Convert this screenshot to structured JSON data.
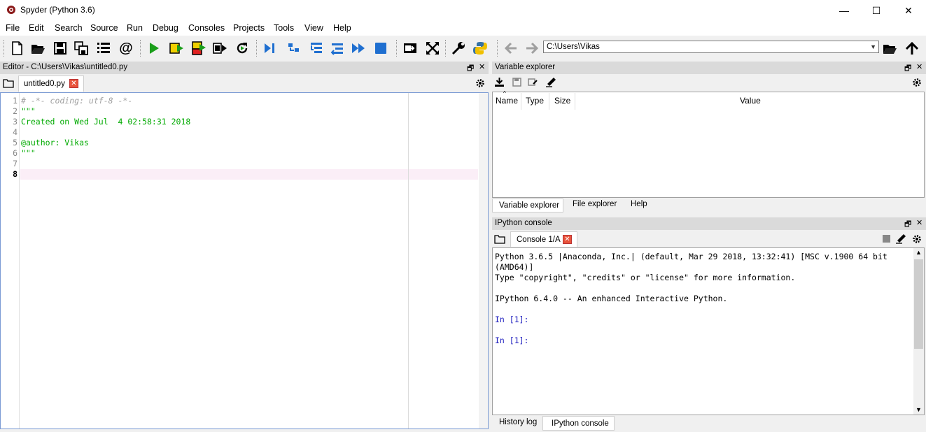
{
  "window": {
    "title": "Spyder (Python 3.6)",
    "minimize": "—",
    "maximize": "☐",
    "close": "✕"
  },
  "menu": [
    "File",
    "Edit",
    "Search",
    "Source",
    "Run",
    "Debug",
    "Consoles",
    "Projects",
    "Tools",
    "View",
    "Help"
  ],
  "toolbar": {
    "working_directory": "C:\\Users\\Vikas",
    "icons": [
      "new-file-icon",
      "open-file-icon",
      "save-icon",
      "save-all-icon",
      "outline-icon",
      "at-icon",
      "run-icon",
      "run-cell-icon",
      "run-cell-advance-icon",
      "run-selection-icon",
      "rerun-icon",
      "debug-icon",
      "step-icon",
      "step-into-icon",
      "step-return-icon",
      "continue-icon",
      "stop-icon",
      "maximize-pane-icon",
      "fullscreen-icon",
      "preferences-icon",
      "python-path-icon",
      "back-icon",
      "forward-icon",
      "browse-icon",
      "parent-dir-icon"
    ]
  },
  "editor": {
    "pane_title": "Editor - C:\\Users\\Vikas\\untitled0.py",
    "tab_label": "untitled0.py",
    "current_line": 8,
    "colors": {
      "comment": "#a0a0a0",
      "docstring": "#00aa00",
      "linenum": "#888888",
      "current_line_bg": "#fbeef7"
    },
    "lines": [
      {
        "num": "1",
        "text": "# -*- coding: utf-8 -*-"
      },
      {
        "num": "2",
        "text": "\"\"\""
      },
      {
        "num": "3",
        "text": "Created on Wed Jul  4 02:58:31 2018"
      },
      {
        "num": "4",
        "text": ""
      },
      {
        "num": "5",
        "text": "@author: Vikas"
      },
      {
        "num": "6",
        "text": "\"\"\""
      },
      {
        "num": "7",
        "text": ""
      },
      {
        "num": "8",
        "text": ""
      }
    ]
  },
  "variable_explorer": {
    "pane_title": "Variable explorer",
    "columns": [
      "Name",
      "Type",
      "Size",
      "Value"
    ],
    "tabs": [
      "Variable explorer",
      "File explorer",
      "Help"
    ]
  },
  "ipython_console": {
    "pane_title": "IPython console",
    "tab_label": "Console 1/A",
    "lines": [
      {
        "text": "Python 3.6.5 |Anaconda, Inc.| (default, Mar 29 2018, 13:32:41) [MSC v.1900 64 bit",
        "color": "#000000"
      },
      {
        "text": "(AMD64)]",
        "color": "#000000"
      },
      {
        "text": "Type \"copyright\", \"credits\" or \"license\" for more information.",
        "color": "#000000"
      },
      {
        "text": "",
        "color": "#000000"
      },
      {
        "text": "IPython 6.4.0 -- An enhanced Interactive Python.",
        "color": "#000000"
      },
      {
        "text": "",
        "color": "#000000"
      },
      {
        "text": "In [1]:",
        "color": "#1f1fbf"
      },
      {
        "text": "",
        "color": "#000000"
      },
      {
        "text": "In [1]:",
        "color": "#1f1fbf"
      }
    ],
    "tabs": [
      "History log",
      "IPython console"
    ]
  }
}
